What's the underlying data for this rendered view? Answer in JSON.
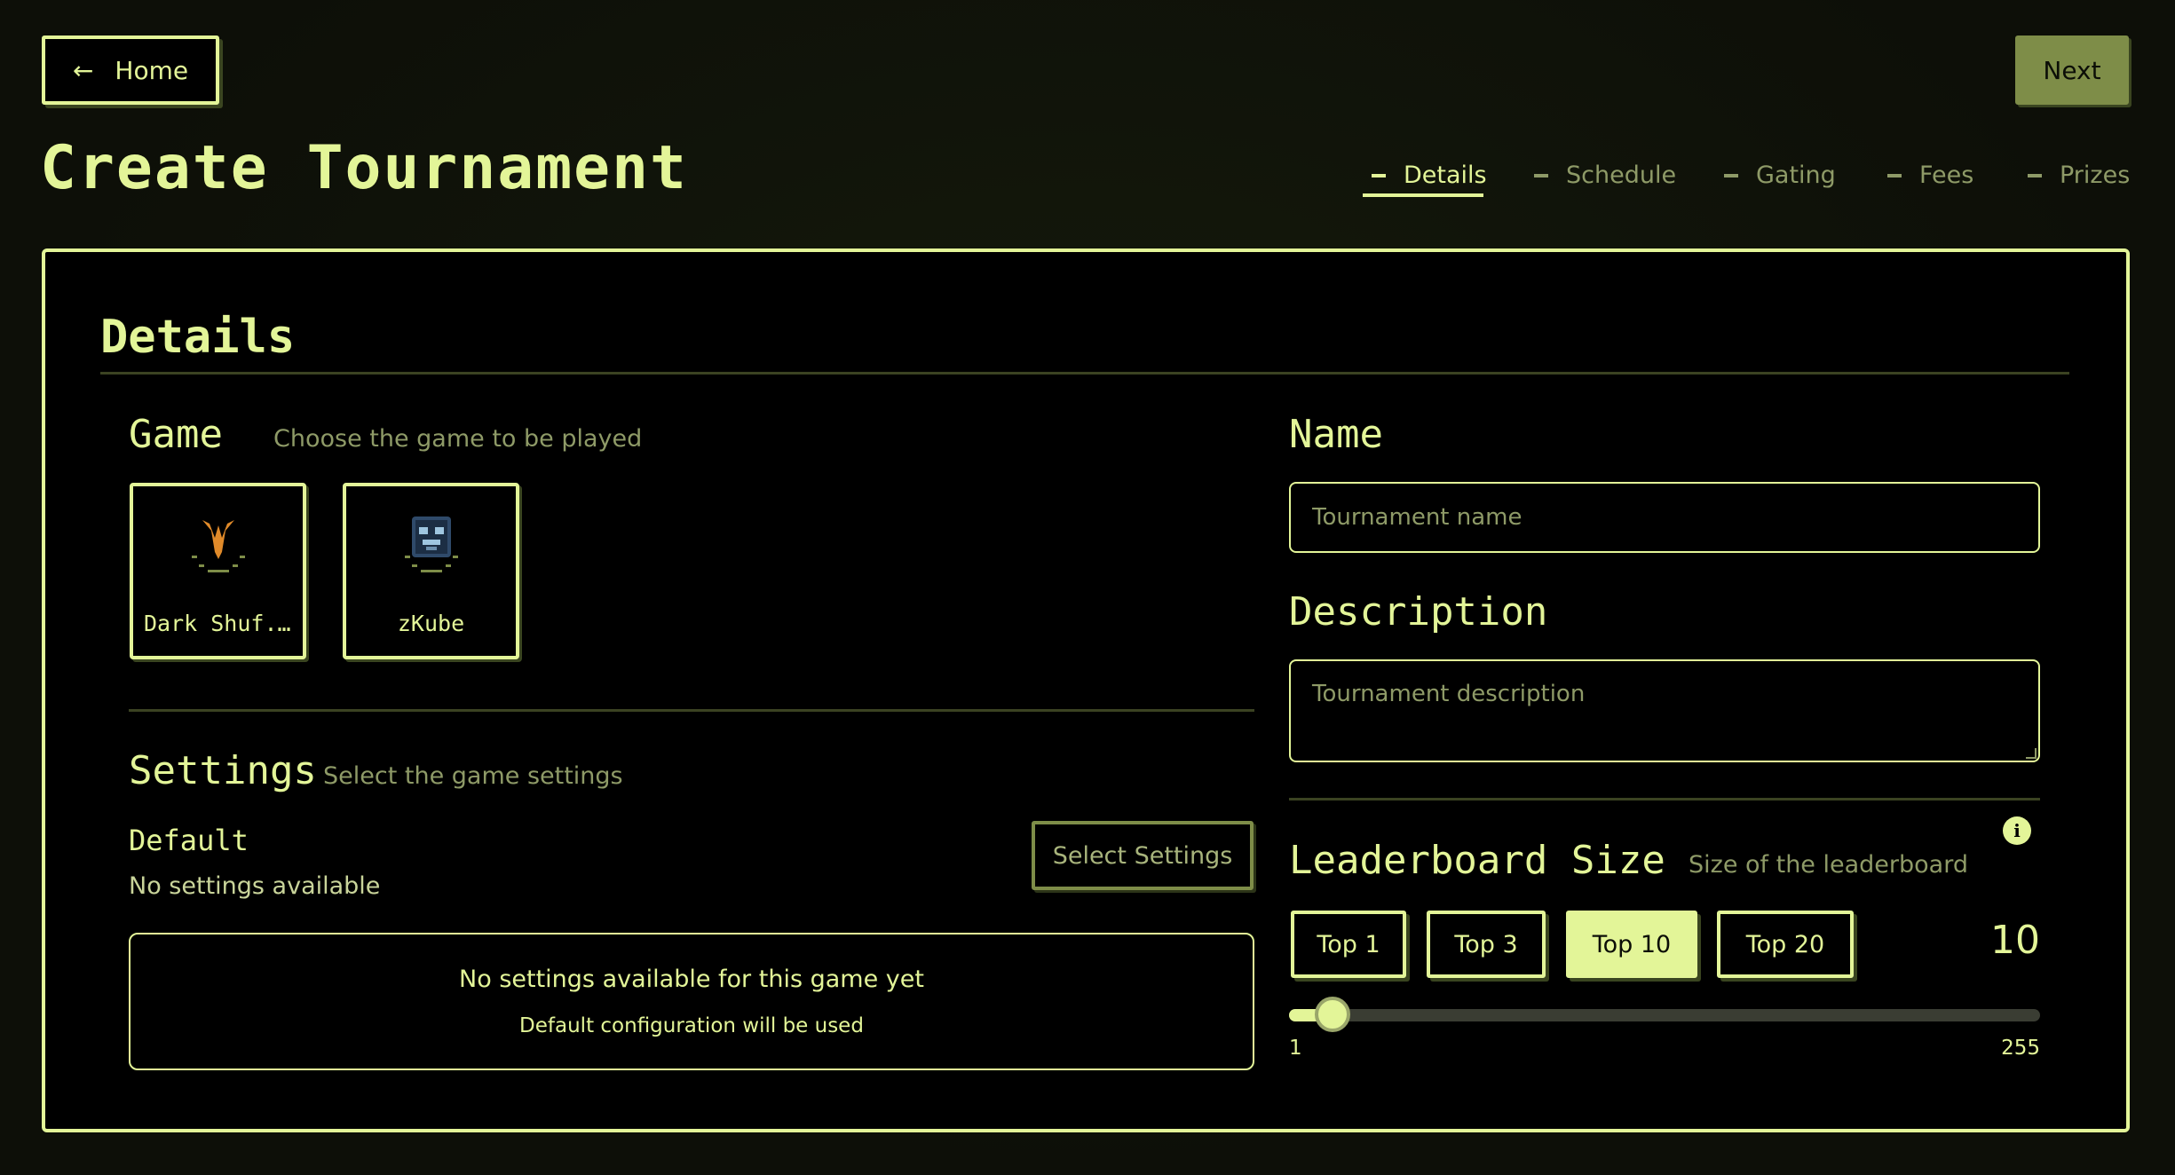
{
  "header": {
    "home_label": "Home",
    "next_label": "Next",
    "title": "Create Tournament",
    "steps": [
      {
        "label": "Details",
        "active": true
      },
      {
        "label": "Schedule",
        "active": false
      },
      {
        "label": "Gating",
        "active": false
      },
      {
        "label": "Fees",
        "active": false
      },
      {
        "label": "Prizes",
        "active": false
      }
    ]
  },
  "details": {
    "heading": "Details",
    "game": {
      "label": "Game",
      "subtitle": "Choose the game to be played",
      "options": [
        {
          "name": "Dark Shuf...",
          "icon": "dark-shuffle-logo-icon"
        },
        {
          "name": "zKube",
          "icon": "zkube-logo-icon"
        }
      ]
    },
    "settings": {
      "label": "Settings",
      "subtitle": "Select the game settings",
      "current_name": "Default",
      "current_desc": "No settings available",
      "select_button": "Select Settings",
      "empty_title": "No settings available for this game yet",
      "empty_sub": "Default configuration will be used"
    },
    "name": {
      "label": "Name",
      "placeholder": "Tournament name",
      "value": ""
    },
    "description": {
      "label": "Description",
      "placeholder": "Tournament description",
      "value": ""
    },
    "leaderboard": {
      "label": "Leaderboard Size",
      "subtitle": "Size of the leaderboard",
      "options": [
        "Top 1",
        "Top 3",
        "Top 10",
        "Top 20"
      ],
      "selected_index": 2,
      "value": "10",
      "min": "1",
      "max": "255",
      "slider_value": 10
    }
  },
  "colors": {
    "accent": "#e3f598",
    "muted": "#8e9a67",
    "background": "#0f110a",
    "panel": "#000000"
  }
}
